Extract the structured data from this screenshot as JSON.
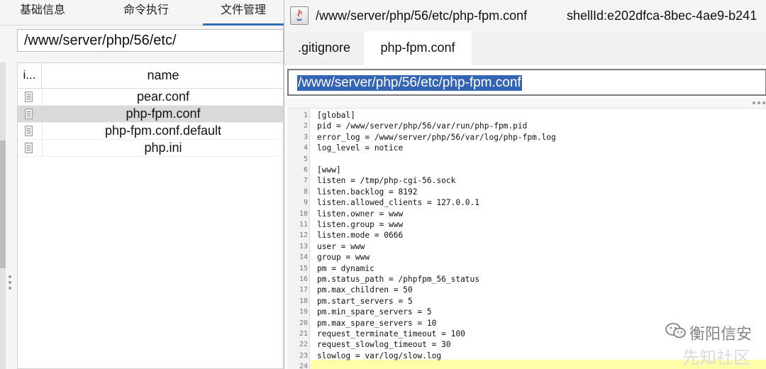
{
  "main_tabs": [
    {
      "label": "基础信息"
    },
    {
      "label": "命令执行"
    },
    {
      "label": "文件管理",
      "active": true
    }
  ],
  "file_manager": {
    "current_path": "/www/server/php/56/etc/",
    "columns": {
      "icon": "i...",
      "name": "name"
    },
    "files": [
      {
        "name": "pear.conf",
        "icon": "file-icon"
      },
      {
        "name": "php-fpm.conf",
        "icon": "file-icon",
        "selected": true
      },
      {
        "name": "php-fpm.conf.default",
        "icon": "file-icon"
      },
      {
        "name": "php.ini",
        "icon": "file-icon"
      }
    ]
  },
  "editor": {
    "icon": "java-app-icon",
    "title": "/www/server/php/56/etc/php-fpm.conf",
    "shell_id": "shellId:e202dfca-8bec-4ae9-b241",
    "tabs": [
      {
        "label": ".gitignore"
      },
      {
        "label": "php-fpm.conf",
        "active": true
      }
    ],
    "path_value": "/www/server/php/56/etc/php-fpm.conf",
    "lines": [
      "[global]",
      "pid = /www/server/php/56/var/run/php-fpm.pid",
      "error_log = /www/server/php/56/var/log/php-fpm.log",
      "log_level = notice",
      "",
      "[www]",
      "listen = /tmp/php-cgi-56.sock",
      "listen.backlog = 8192",
      "listen.allowed_clients = 127.0.0.1",
      "listen.owner = www",
      "listen.group = www",
      "listen.mode = 0666",
      "user = www",
      "group = www",
      "pm = dynamic",
      "pm.status_path = /phpfpm_56_status",
      "pm.max_children = 50",
      "pm.start_servers = 5",
      "pm.min_spare_servers = 5",
      "pm.max_spare_servers = 10",
      "request_terminate_timeout = 100",
      "request_slowlog_timeout = 30",
      "slowlog = var/log/slow.log",
      ""
    ],
    "current_line": 24
  },
  "watermark": {
    "text": "衡阳信安",
    "icon": "wechat-icon",
    "faint_text": "先知社区"
  },
  "colors": {
    "accent": "#2f6fb5",
    "selection": "#3464b4",
    "current_line": "#ffffaa",
    "row_selected": "#d9d9d9"
  }
}
